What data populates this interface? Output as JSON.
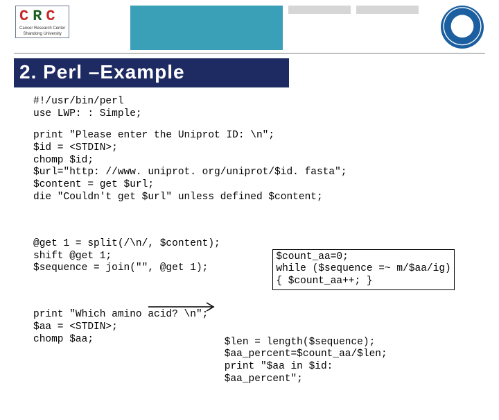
{
  "logo": {
    "letter1": "C",
    "letter2": "R",
    "letter3": "C",
    "sub1": "Cancer Research Center",
    "sub2": "Shandong University"
  },
  "title": "2. Perl –Example",
  "code": {
    "block1": "#!/usr/bin/perl\nuse LWP: : Simple;",
    "block2": "print \"Please enter the Uniprot ID: \\n\";\n$id = <STDIN>;\nchomp $id;\n$url=\"http: //www. uniprot. org/uniprot/$id. fasta\";\n$content = get $url;\ndie \"Couldn't get $url\" unless defined $content;",
    "leftBlock3": "@get 1 = split(/\\n/, $content);\nshift @get 1;\n$sequence = join(\"\", @get 1);",
    "leftBlock4": "print \"Which amino acid? \\n\";\n$aa = <STDIN>;\nchomp $aa;",
    "rightBlock1": "$count_aa=0;\nwhile ($sequence =~ m/$aa/ig)\n{ $count_aa++; }",
    "rightBlock2": "$len = length($sequence);\n$aa_percent=$count_aa/$len;\nprint \"$aa in $id:\n$aa_percent\";"
  }
}
